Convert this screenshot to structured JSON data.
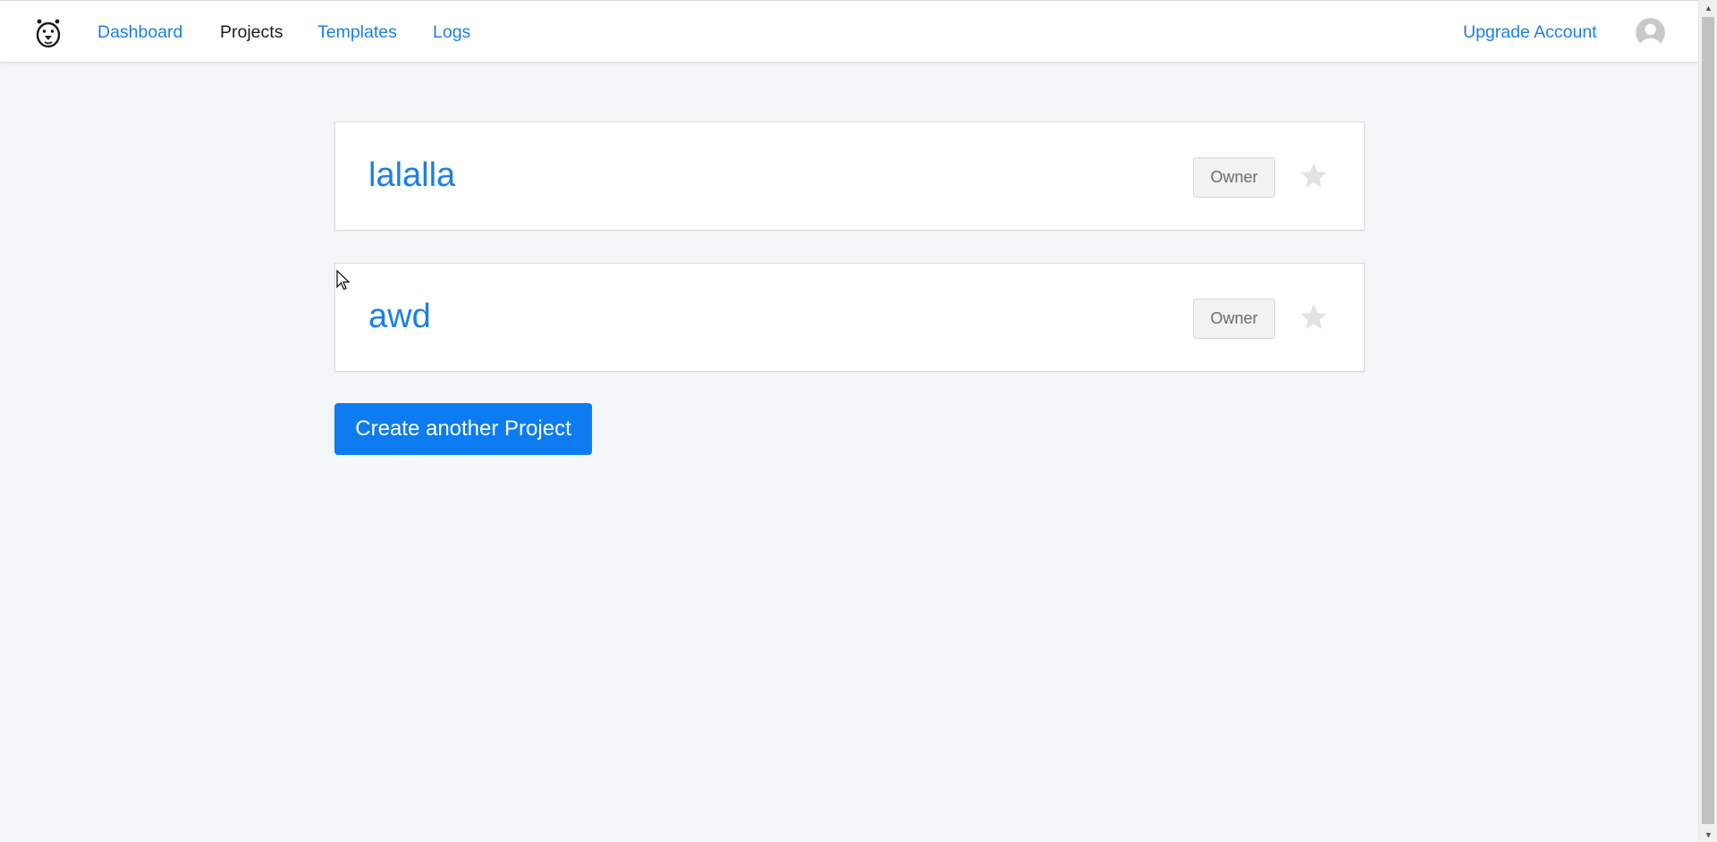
{
  "nav": {
    "links": [
      {
        "label": "Dashboard",
        "active": false
      },
      {
        "label": "Projects",
        "active": true
      },
      {
        "label": "Templates",
        "active": false
      },
      {
        "label": "Logs",
        "active": false
      }
    ],
    "upgrade_label": "Upgrade Account",
    "logo_icon": "bear-logo-icon",
    "avatar_icon": "user-avatar-icon"
  },
  "projects": [
    {
      "title": "lalalla",
      "role": "Owner",
      "starred": false
    },
    {
      "title": "awd",
      "role": "Owner",
      "starred": false
    }
  ],
  "create_button_label": "Create another Project",
  "colors": {
    "accent": "#1a7fe6",
    "primary_button": "#0d7cf2",
    "background": "#f5f6f8",
    "star_inactive": "#e2e2e2"
  }
}
